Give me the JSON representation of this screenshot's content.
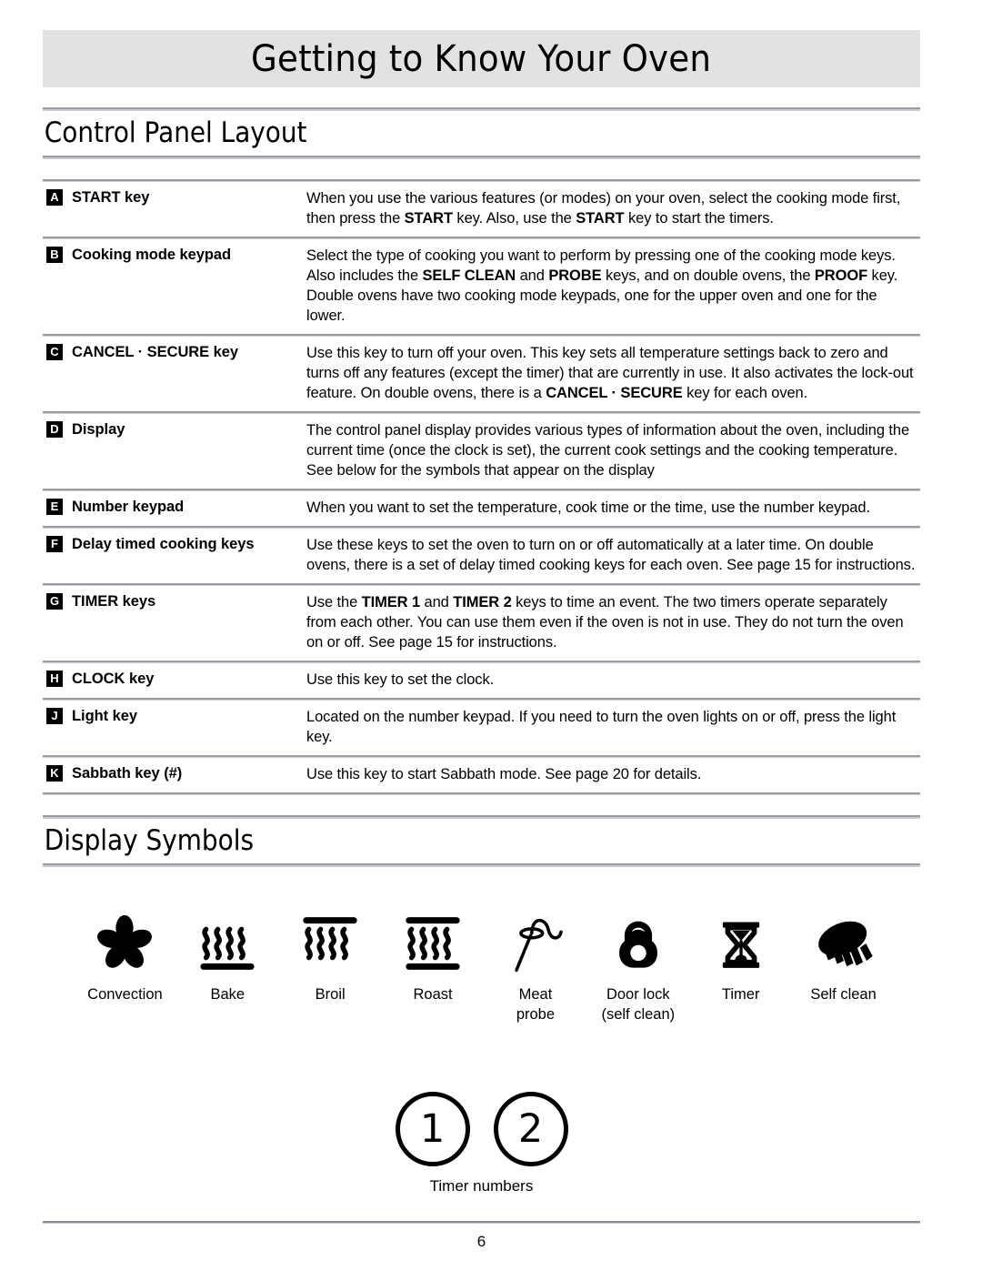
{
  "header": {
    "chapter_title": "Getting to Know Your Oven"
  },
  "sections": {
    "control_panel": {
      "heading": "Control Panel Layout"
    },
    "display_symbols": {
      "heading": "Display Symbols"
    }
  },
  "control_panel_rows": [
    {
      "badge": "A",
      "term": "START key",
      "desc_parts": [
        {
          "t": "When you use the various features (or modes) on your oven, select the cooking mode first, then press the "
        },
        {
          "t": "START",
          "b": true
        },
        {
          "t": " key. Also, use the "
        },
        {
          "t": "START",
          "b": true
        },
        {
          "t": " key to start the timers."
        }
      ]
    },
    {
      "badge": "B",
      "term": "Cooking mode keypad",
      "desc_parts": [
        {
          "t": "Select the type of cooking you want to perform by pressing one of the cooking mode keys. Also includes the "
        },
        {
          "t": "SELF CLEAN",
          "b": true
        },
        {
          "t": " and "
        },
        {
          "t": "PROBE",
          "b": true
        },
        {
          "t": " keys, and on double ovens, the "
        },
        {
          "t": "PROOF",
          "b": true
        },
        {
          "t": " key. Double ovens have two cooking mode keypads, one for the upper oven and one for the lower."
        }
      ]
    },
    {
      "badge": "C",
      "term": "CANCEL · SECURE key",
      "desc_parts": [
        {
          "t": "Use this key to turn off your oven. This key sets all temperature settings back to zero and turns off any features (except the timer) that are currently in use. It also activates the lock-out feature. On double ovens, there is a "
        },
        {
          "t": "CANCEL · SECURE",
          "b": true
        },
        {
          "t": " key for each oven."
        }
      ]
    },
    {
      "badge": "D",
      "term": "Display",
      "desc_parts": [
        {
          "t": "The control panel display provides various types of information about the oven, including the current time (once the clock is set), the current cook settings and the cooking temperature. See below for the symbols that appear on the display"
        }
      ]
    },
    {
      "badge": "E",
      "term": "Number keypad",
      "desc_parts": [
        {
          "t": "When you want to set the temperature, cook time or the time, use the number keypad."
        }
      ]
    },
    {
      "badge": "F",
      "term": "Delay timed cooking keys",
      "desc_parts": [
        {
          "t": "Use these keys to set the oven to turn on or off automatically at a later time. On double ovens, there is a set of delay timed cooking keys for each oven. See page 15 for instructions."
        }
      ]
    },
    {
      "badge": "G",
      "term": "TIMER keys",
      "desc_parts": [
        {
          "t": "Use the "
        },
        {
          "t": "TIMER 1",
          "b": true
        },
        {
          "t": " and "
        },
        {
          "t": "TIMER 2",
          "b": true
        },
        {
          "t": " keys to time an event. The two timers operate separately from each other. You can use them even if the oven is not in use. They do not turn the oven on or off. See page 15 for instructions."
        }
      ]
    },
    {
      "badge": "H",
      "term": "CLOCK key",
      "desc_parts": [
        {
          "t": "Use this key to set the clock."
        }
      ]
    },
    {
      "badge": "J",
      "term": "Light key",
      "desc_parts": [
        {
          "t": "Located on the number keypad. If you need to turn the oven lights on or off, press the light key."
        }
      ]
    },
    {
      "badge": "K",
      "term": "Sabbath key (#)",
      "desc_parts": [
        {
          "t": "Use this key to start Sabbath mode. See page 20 for details."
        }
      ]
    }
  ],
  "display_symbols": [
    {
      "icon": "convection-fan-icon",
      "label": "Convection"
    },
    {
      "icon": "bake-element-icon",
      "label": "Bake"
    },
    {
      "icon": "broil-element-icon",
      "label": "Broil"
    },
    {
      "icon": "roast-element-icon",
      "label": "Roast"
    },
    {
      "icon": "meat-probe-icon",
      "label": "Meat\nprobe"
    },
    {
      "icon": "door-lock-icon",
      "label": "Door lock\n(self clean)"
    },
    {
      "icon": "hourglass-timer-icon",
      "label": "Timer"
    },
    {
      "icon": "self-clean-brush-icon",
      "label": "Self clean"
    }
  ],
  "timer_numbers": {
    "values": [
      "1",
      "2"
    ],
    "label": "Timer numbers"
  },
  "footer": {
    "page_number": "6"
  },
  "colors": {
    "banner_background": "#e1e2e4",
    "rule": "#9a9aa2",
    "text": "#000000",
    "badge_background": "#000000",
    "badge_text": "#ffffff"
  }
}
